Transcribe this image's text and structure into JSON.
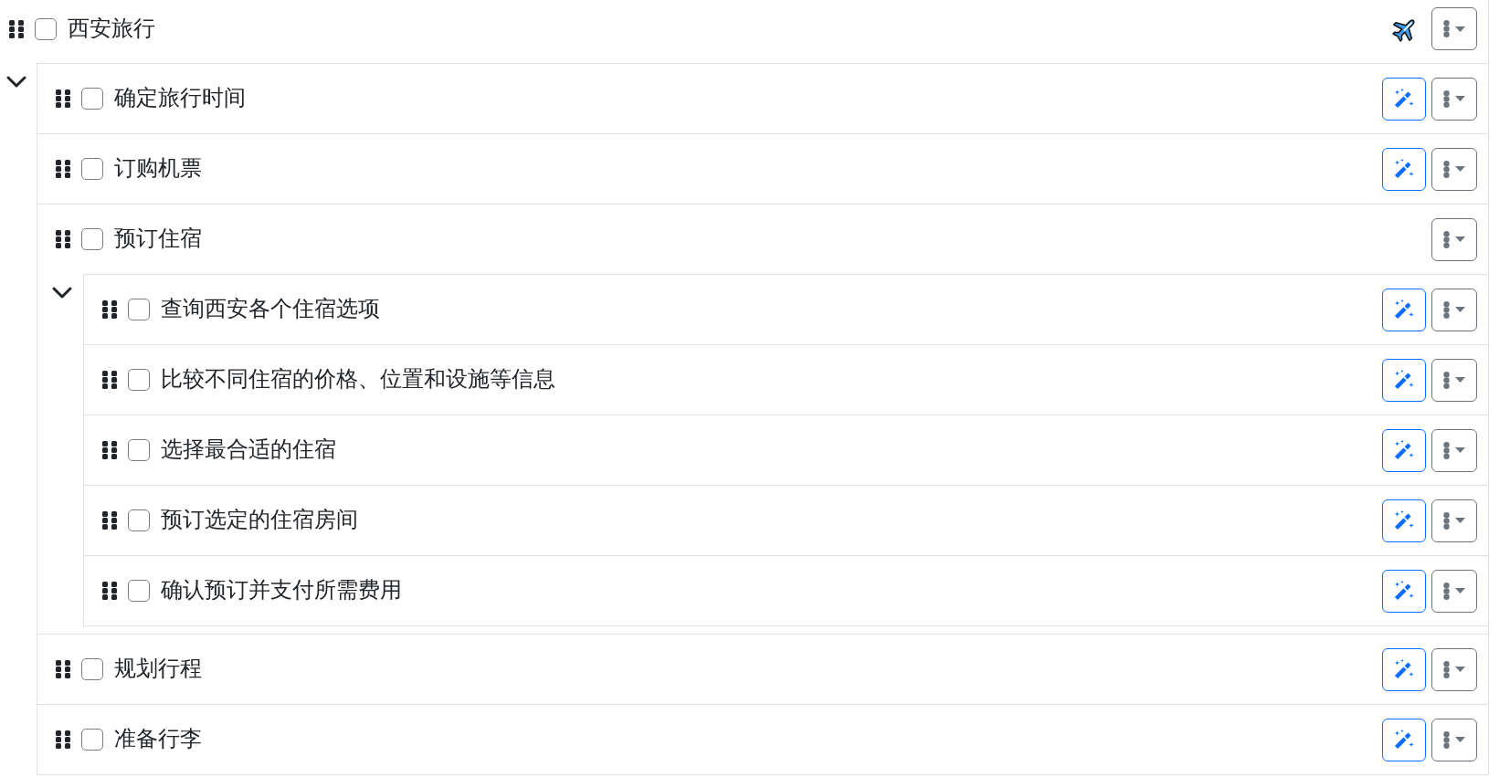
{
  "goal": {
    "label": "西安旅行",
    "checked": false,
    "magic_button": false,
    "expanded": true,
    "children": [
      {
        "label": "确定旅行时间",
        "checked": false,
        "magic_button": true
      },
      {
        "label": "订购机票",
        "checked": false,
        "magic_button": true
      },
      {
        "label": "预订住宿",
        "checked": false,
        "magic_button": false,
        "expanded": true,
        "children": [
          {
            "label": "查询西安各个住宿选项",
            "checked": false,
            "magic_button": true
          },
          {
            "label": "比较不同住宿的价格、位置和设施等信息",
            "checked": false,
            "magic_button": true
          },
          {
            "label": "选择最合适的住宿",
            "checked": false,
            "magic_button": true
          },
          {
            "label": "预订选定的住宿房间",
            "checked": false,
            "magic_button": true
          },
          {
            "label": "确认预订并支付所需费用",
            "checked": false,
            "magic_button": true
          }
        ]
      },
      {
        "label": "规划行程",
        "checked": false,
        "magic_button": true
      },
      {
        "label": "准备行李",
        "checked": false,
        "magic_button": true
      }
    ]
  }
}
